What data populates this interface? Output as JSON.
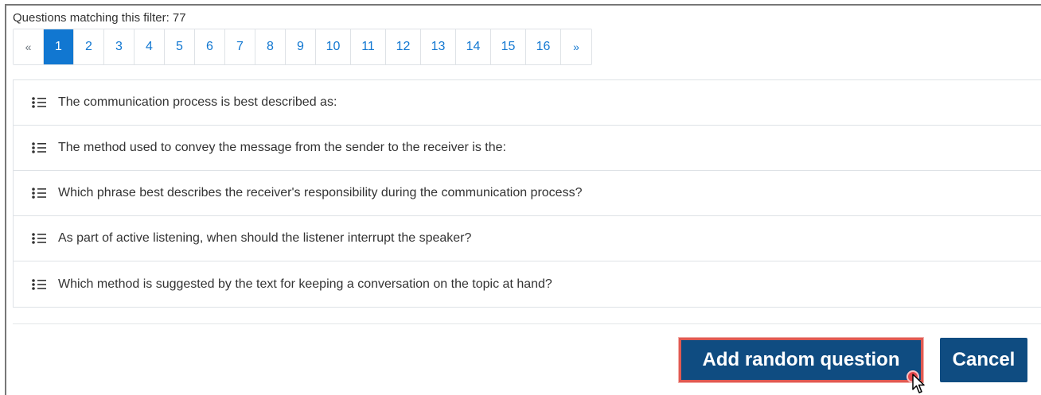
{
  "filter": {
    "match_text": "Questions matching this filter: 77"
  },
  "pagination": {
    "prev_label": "«",
    "next_label": "»",
    "pages": [
      "1",
      "2",
      "3",
      "4",
      "5",
      "6",
      "7",
      "8",
      "9",
      "10",
      "11",
      "12",
      "13",
      "14",
      "15",
      "16"
    ],
    "current_page": "1"
  },
  "questions": [
    {
      "icon": "multichoice-icon",
      "text": "The communication process is best described as:"
    },
    {
      "icon": "multichoice-icon",
      "text": "The method used to convey the message from the sender to the receiver is the:"
    },
    {
      "icon": "multichoice-icon",
      "text": "Which phrase best describes the receiver's responsibility during the communication process?"
    },
    {
      "icon": "multichoice-icon",
      "text": "As part of active listening, when should the listener interrupt the speaker?"
    },
    {
      "icon": "multichoice-icon",
      "text": "Which method is suggested by the text for keeping a conversation on the topic at hand?"
    }
  ],
  "actions": {
    "add_label": "Add random question",
    "cancel_label": "Cancel"
  },
  "colors": {
    "accent": "#1177d1",
    "primary_button": "#0f4c81",
    "highlight": "#e05a52"
  }
}
